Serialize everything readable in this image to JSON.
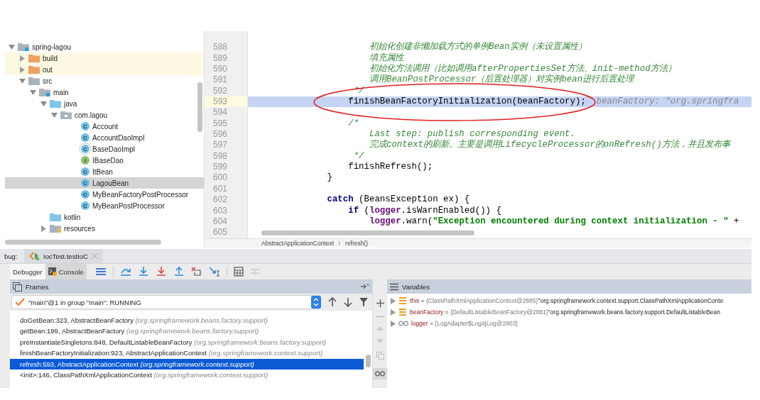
{
  "project_tree": {
    "items": [
      {
        "label": "spring-lagou",
        "kind": "module",
        "expanded": true,
        "selected": false,
        "children": [
          {
            "label": "build",
            "kind": "excluded",
            "expanded": false,
            "selected": false
          },
          {
            "label": "out",
            "kind": "excluded",
            "expanded": false,
            "selected": false
          },
          {
            "label": "src",
            "kind": "folder",
            "expanded": true,
            "selected": false,
            "children": [
              {
                "label": "main",
                "kind": "module",
                "expanded": true,
                "selected": false,
                "children": [
                  {
                    "label": "java",
                    "kind": "source",
                    "expanded": true,
                    "selected": false,
                    "children": [
                      {
                        "label": "com.lagou",
                        "kind": "package",
                        "expanded": true,
                        "selected": false,
                        "children": [
                          {
                            "label": "Account",
                            "kind": "class",
                            "letter": "C",
                            "selected": false
                          },
                          {
                            "label": "AccountDaoImpl",
                            "kind": "class",
                            "letter": "C",
                            "selected": false
                          },
                          {
                            "label": "BaseDaoImpl",
                            "kind": "abstract",
                            "letter": "C",
                            "selected": false
                          },
                          {
                            "label": "IBaseDao",
                            "kind": "interface",
                            "letter": "I",
                            "selected": false
                          },
                          {
                            "label": "ItBean",
                            "kind": "class",
                            "letter": "C",
                            "selected": false
                          },
                          {
                            "label": "LagouBean",
                            "kind": "class",
                            "letter": "C",
                            "selected": true
                          },
                          {
                            "label": "MyBeanFactoryPostProcessor",
                            "kind": "class",
                            "letter": "C",
                            "selected": false
                          },
                          {
                            "label": "MyBeanPostProcessor",
                            "kind": "class",
                            "letter": "C",
                            "selected": false
                          }
                        ]
                      }
                    ]
                  },
                  {
                    "label": "kotlin",
                    "kind": "source",
                    "selected": false
                  },
                  {
                    "label": "resources",
                    "kind": "resources",
                    "expanded": false,
                    "selected": false
                  }
                ]
              }
            ]
          }
        ]
      }
    ]
  },
  "editor": {
    "lines": [
      {
        "number": "588",
        "selected": false,
        "segments": [
          {
            "kind": "comment",
            "t": "                初始化创建非懒加载方式的单例Bean实例（未设置属性）"
          }
        ]
      },
      {
        "number": "589",
        "selected": false,
        "segments": [
          {
            "kind": "comment",
            "t": "                填充属性"
          }
        ]
      },
      {
        "number": "590",
        "selected": false,
        "segments": [
          {
            "kind": "comment",
            "t": "                初始化方法调用（比如调用afterPropertiesSet方法、init-method方法）"
          }
        ]
      },
      {
        "number": "591",
        "selected": false,
        "segments": [
          {
            "kind": "comment",
            "t": "                调用BeanPostProcessor（后置处理器）对实例bean进行后置处理"
          }
        ]
      },
      {
        "number": "592",
        "selected": false,
        "segments": [
          {
            "kind": "comment",
            "t": "             */"
          }
        ]
      },
      {
        "number": "593",
        "selected": true,
        "segments": [
          {
            "kind": "plain",
            "t": "            finishBeanFactoryInitialization(beanFactory);"
          },
          {
            "kind": "hint",
            "t": "  beanFactory: \"org.springfra"
          }
        ]
      },
      {
        "number": "594",
        "selected": false
      },
      {
        "number": "595",
        "selected": false,
        "segments": [
          {
            "kind": "comment",
            "t": "            /*"
          }
        ]
      },
      {
        "number": "596",
        "selected": false,
        "segments": [
          {
            "kind": "comment",
            "t": "                Last step: publish corresponding event."
          }
        ]
      },
      {
        "number": "597",
        "selected": false,
        "segments": [
          {
            "kind": "comment",
            "t": "                完成context的刷新。主要是调用LifecycleProcessor的onRefresh()方法，并且发布事"
          }
        ]
      },
      {
        "number": "598",
        "selected": false,
        "segments": [
          {
            "kind": "comment",
            "t": "             */"
          }
        ]
      },
      {
        "number": "599",
        "selected": false,
        "segments": [
          {
            "kind": "plain",
            "t": "            finishRefresh();"
          }
        ]
      },
      {
        "number": "600",
        "selected": false,
        "segments": [
          {
            "kind": "plain",
            "t": "        }"
          }
        ]
      },
      {
        "number": "601",
        "selected": false
      },
      {
        "number": "602",
        "selected": false,
        "segments": [
          {
            "kind": "keyword",
            "t": "        catch"
          },
          {
            "kind": "plain",
            "t": " (BeansException ex) {"
          }
        ]
      },
      {
        "number": "603",
        "selected": false,
        "segments": [
          {
            "kind": "keyword",
            "t": "            if"
          },
          {
            "kind": "plain",
            "t": " ("
          },
          {
            "kind": "field",
            "t": "logger"
          },
          {
            "kind": "plain",
            "t": ".isWarnEnabled()) {"
          }
        ]
      },
      {
        "number": "604",
        "selected": false,
        "segments": [
          {
            "kind": "field",
            "t": "                logger"
          },
          {
            "kind": "plain",
            "t": ".warn("
          },
          {
            "kind": "string",
            "t": "\"Exception encountered during context initialization - \""
          },
          {
            "kind": "plain",
            "t": " +"
          }
        ]
      },
      {
        "number": "605",
        "selected": false
      }
    ],
    "breadcrumbs": [
      "AbstractApplicationContext",
      "refresh()"
    ]
  },
  "debug": {
    "label": "bug:",
    "session_tab": "IocTest.testIoC",
    "tabs": [
      {
        "label": "Debugger",
        "selected": true
      },
      {
        "label": "Console",
        "selected": false
      }
    ],
    "frames": {
      "title": "Frames",
      "thread": "\"main\"@1 in group \"main\": RUNNING",
      "rows": [
        {
          "method": "doGetBean:323, AbstractBeanFactory",
          "package": "(org.springframework.beans.factory.support)",
          "selected": false
        },
        {
          "method": "getBean:199, AbstractBeanFactory",
          "package": "(org.springframework.beans.factory.support)",
          "selected": false
        },
        {
          "method": "preInstantiateSingletons:848, DefaultListableBeanFactory",
          "package": "(org.springframework.beans.factory.support)",
          "selected": false
        },
        {
          "method": "finishBeanFactoryInitialization:923, AbstractApplicationContext",
          "package": "(org.springframework.context.support)",
          "selected": false
        },
        {
          "method": "refresh:593, AbstractApplicationContext",
          "package": "(org.springframework.context.support)",
          "selected": true
        },
        {
          "method": "<init>:146, ClassPathXmlApplicationContext",
          "package": "(org.springframework.context.support)",
          "selected": false
        }
      ]
    },
    "variables": {
      "title": "Variables",
      "rows": [
        {
          "kind": "field",
          "name": "this",
          "operator": "=",
          "value": "{ClassPathXmlApplicationContext@2885}",
          "text": "\"org.springframework.context.support.ClassPathXmlApplicationConte"
        },
        {
          "kind": "field",
          "name": "beanFactory",
          "operator": "=",
          "value": "{DefaultListableBeanFactory@2881}",
          "text": "\"org.springframework.beans.factory.support.DefaultListableBean"
        },
        {
          "kind": "static",
          "name": "logger",
          "operator": "=",
          "value": "{LogAdapter$Log4jLog@2903}"
        }
      ]
    }
  }
}
